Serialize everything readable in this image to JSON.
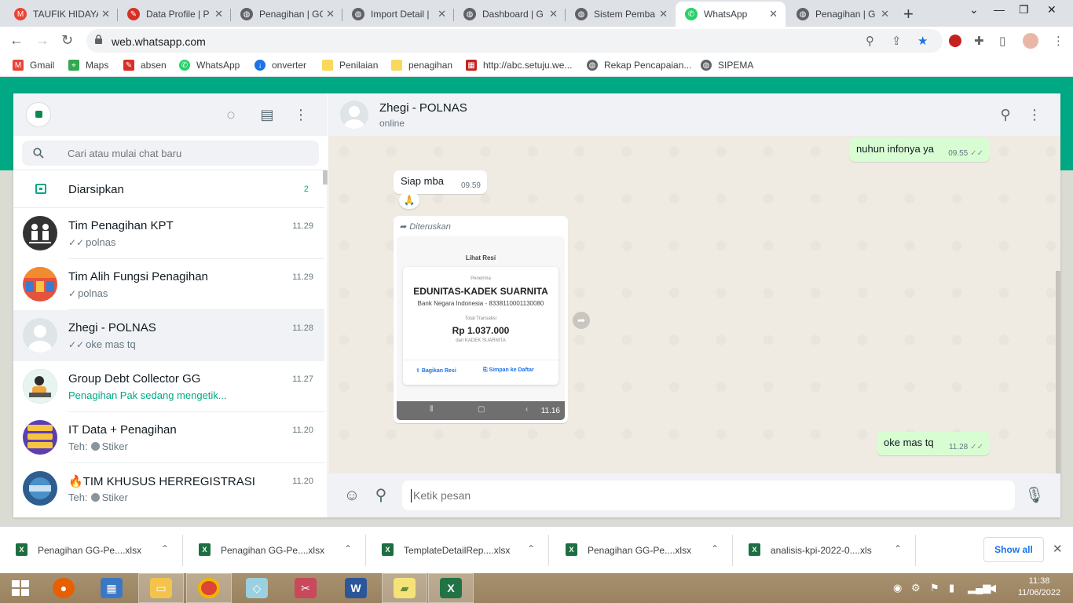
{
  "browser": {
    "tabs": [
      {
        "title": "TAUFIK HIDAYA",
        "icon": "gmail-icon",
        "color": "#ea4335",
        "active": false
      },
      {
        "title": "Data Profile | P",
        "icon": "feather-icon",
        "color": "#d93025",
        "active": false
      },
      {
        "title": "Penagihan | GG",
        "icon": "globe-icon",
        "color": "#5f6368",
        "active": false
      },
      {
        "title": "Import Detail |",
        "icon": "globe-icon",
        "color": "#5f6368",
        "active": false
      },
      {
        "title": "Dashboard | G",
        "icon": "globe-icon",
        "color": "#5f6368",
        "active": false
      },
      {
        "title": "Sistem Pemba",
        "icon": "globe-icon",
        "color": "#5f6368",
        "active": false
      },
      {
        "title": "WhatsApp",
        "icon": "whatsapp-icon",
        "color": "#25d366",
        "active": true
      },
      {
        "title": "Penagihan | G",
        "icon": "globe-icon",
        "color": "#5f6368",
        "active": false
      }
    ],
    "url": "web.whatsapp.com",
    "bookmarks": [
      {
        "label": "Gmail",
        "icon": "gmail-icon",
        "color": "#ea4335"
      },
      {
        "label": "Maps",
        "icon": "maps-icon",
        "color": "#34a853"
      },
      {
        "label": "absen",
        "icon": "feather-icon",
        "color": "#d93025"
      },
      {
        "label": "WhatsApp",
        "icon": "whatsapp-icon",
        "color": "#25d366"
      },
      {
        "label": "onverter",
        "icon": "converter-icon",
        "color": "#1a73e8"
      },
      {
        "label": "Penilaian",
        "icon": "folder-icon",
        "color": "#f9d85b"
      },
      {
        "label": "penagihan",
        "icon": "folder-icon",
        "color": "#f9d85b"
      },
      {
        "label": "http://abc.setuju.we...",
        "icon": "bank-icon",
        "color": "#c5221f"
      },
      {
        "label": "Rekap Pencapaian...",
        "icon": "globe-icon",
        "color": "#5f6368"
      },
      {
        "label": "SIPEMA",
        "icon": "globe-icon",
        "color": "#5f6368"
      }
    ]
  },
  "sidebar": {
    "search_placeholder": "Cari atau mulai chat baru",
    "archived": {
      "label": "Diarsipkan",
      "count": "2"
    },
    "chats": [
      {
        "name": "Tim Penagihan KPT",
        "time": "11.29",
        "tick": "✓✓",
        "preview": "polnas",
        "avatar_color": "#333333"
      },
      {
        "name": "Tim Alih Fungsi Penagihan",
        "time": "11.29",
        "tick": "✓",
        "preview": "polnas",
        "avatar_color": "#e5533d"
      },
      {
        "name": "Zhegi - POLNAS",
        "time": "11.28",
        "tick": "✓✓",
        "preview": "oke mas tq",
        "avatar_color": "#dfe5e7"
      },
      {
        "name": "Group Debt Collector GG",
        "time": "11.27",
        "tick": "",
        "preview": "Penagihan Pak sedang mengetik...",
        "avatar_color": "#3aa8a0"
      },
      {
        "name": "IT Data + Penagihan",
        "time": "11.20",
        "tick": "",
        "preview": "Teh:",
        "sticker": "Stiker",
        "avatar_color": "#5b3fb0"
      },
      {
        "name": "🔥TIM KHUSUS HERREGISTRASI",
        "time": "11.20",
        "tick": "",
        "preview": "Teh:",
        "sticker": "Stiker",
        "avatar_color": "#2e5d8f"
      }
    ]
  },
  "conversation": {
    "name": "Zhegi - POLNAS",
    "status": "online",
    "messages": {
      "m1": {
        "text": "nuhun infonya ya",
        "time": "09.55",
        "tick": "✓✓"
      },
      "m2": {
        "text": "Siap mba",
        "time": "09.59",
        "reaction": "🙏"
      },
      "m3": {
        "forwarded_label": "Diteruskan",
        "image": {
          "header": "Lihat Resi",
          "recipient_label": "Penerima",
          "recipient": "EDUNITAS-KADEK SUARNITA",
          "bank": "Bank Negara Indonesia - 8338110001130080",
          "total_label": "Total Transaksi",
          "amount": "Rp 1.037.000",
          "from": "dari KADEK SUARNITA",
          "action1": "Bagikan Resi",
          "action2": "Simpan ke Daftar"
        },
        "time": "11.16"
      },
      "m4": {
        "text": "oke mas tq",
        "time": "11.28",
        "tick": "✓✓"
      }
    },
    "composer_placeholder": "Ketik pesan"
  },
  "downloads": [
    {
      "name": "Penagihan  GG-Pe....xlsx"
    },
    {
      "name": "Penagihan  GG-Pe....xlsx"
    },
    {
      "name": "TemplateDetailRep....xlsx"
    },
    {
      "name": "Penagihan  GG-Pe....xlsx"
    },
    {
      "name": "analisis-kpi-2022-0....xls"
    }
  ],
  "show_all_label": "Show all",
  "taskbar": {
    "time": "11:38",
    "date": "11/06/2022"
  }
}
